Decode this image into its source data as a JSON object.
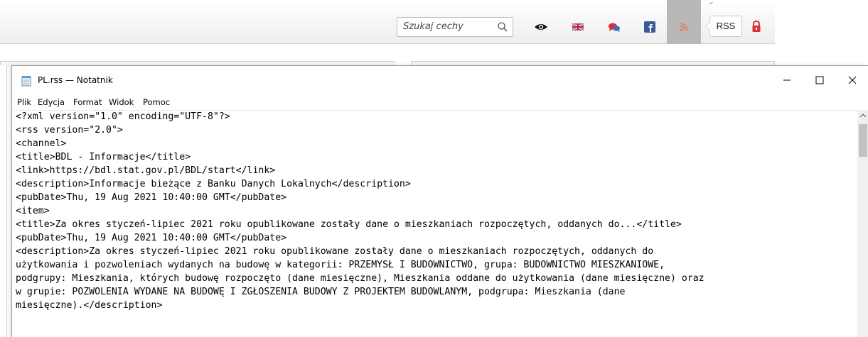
{
  "browser": {
    "search": {
      "placeholder": "Szukaj cechy"
    },
    "icons": [
      "search-icon",
      "eye-icon",
      "uk-flag-icon",
      "chat-icon",
      "facebook-icon",
      "rss-icon",
      "lock-icon"
    ],
    "rss_tooltip": "RSS",
    "colors": {
      "rss": "#e8734a",
      "facebook": "#3b5998",
      "chat": "#d9313b",
      "lock": "#d9313b",
      "active_bg": "#b8b8b8"
    }
  },
  "notepad": {
    "title": "PL.rss — Notatnik",
    "menu": [
      "Plik",
      "Edycja",
      "Format",
      "Widok",
      "Pomoc"
    ],
    "lines": [
      "<?xml version=\"1.0\" encoding=\"UTF-8\"?>",
      "<rss version=\"2.0\">",
      "<channel>",
      "<title>BDL - Informacje</title>",
      "<link>https://bdl.stat.gov.pl/BDL/start</link>",
      "<description>Informacje bieżące z Banku Danych Lokalnych</description>",
      "<pubDate>Thu, 19 Aug 2021 10:40:00 GMT</pubDate>",
      "<item>",
      "<title>Za okres styczeń-lipiec 2021 roku opublikowane zostały dane o mieszkaniach rozpoczętych, oddanych do...</title>",
      "<pubDate>Thu, 19 Aug 2021 10:40:00 GMT</pubDate>",
      "<description>Za okres styczeń-lipiec 2021 roku opublikowane zostały dane o mieszkaniach rozpoczętych, oddanych do",
      "użytkowania i pozwoleniach wydanych na budowę w kategorii: PRZEMYSŁ I BUDOWNICTWO, grupa: BUDOWNICTWO MIESZKANIOWE,",
      "podgrupy: Mieszkania, których budowę rozpoczęto (dane miesięczne), Mieszkania oddane do użytkowania (dane miesięczne) oraz",
      "w grupie: POZWOLENIA WYDANE NA BUDOWĘ I ZGŁOSZENIA BUDOWY Z PROJEKTEM BUDOWLANYM, podgrupa: Mieszkania (dane",
      "miesięczne).</description>"
    ]
  }
}
